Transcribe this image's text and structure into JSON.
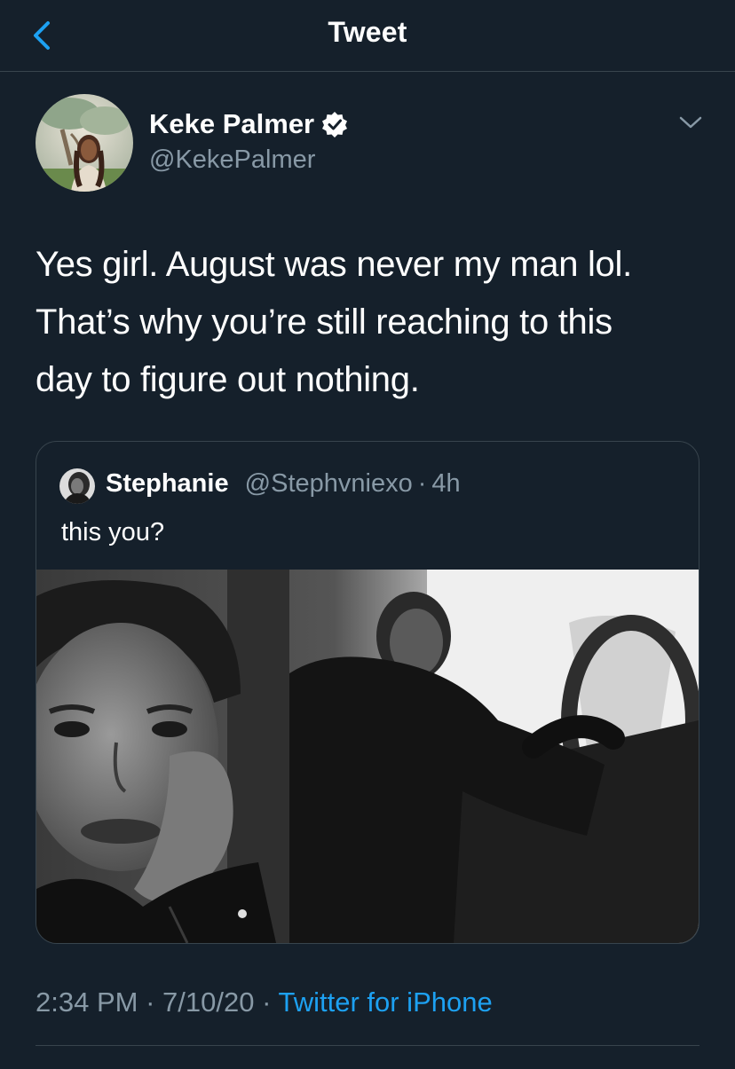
{
  "header": {
    "title": "Tweet",
    "back_icon": "chevron-left-icon"
  },
  "tweet": {
    "author": {
      "name": "Keke Palmer",
      "handle": "@KekePalmer",
      "verified": true
    },
    "text_lines": [
      "Yes girl. August was never my man lol.",
      "That’s why you’re still reaching to this",
      "day to figure out nothing."
    ],
    "quoted": {
      "name": "Stephanie",
      "handle": "@Stephvniexo",
      "separator": "·",
      "time": "4h",
      "text": "this you?",
      "image_desc": "black-and-white photo in car"
    },
    "time": "2:34 PM",
    "dot1": "·",
    "date": "7/10/20",
    "dot2": "·",
    "source": "Twitter for iPhone"
  },
  "colors": {
    "background": "#15202b",
    "secondary_text": "#8899a6",
    "accent": "#1da1f2",
    "border": "#38444d"
  }
}
